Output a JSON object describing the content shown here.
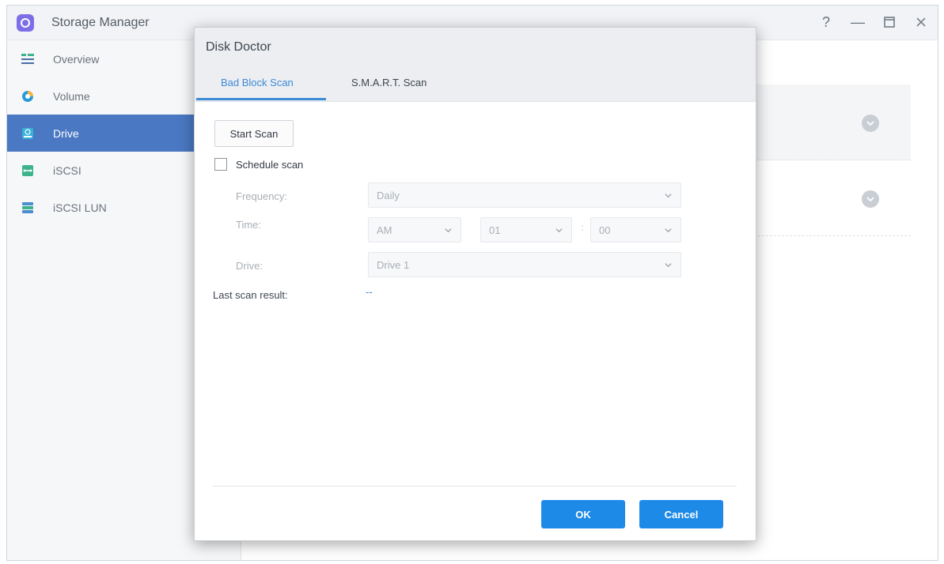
{
  "window": {
    "title": "Storage Manager",
    "controls": {
      "help": "?",
      "minimize": "—"
    }
  },
  "sidebar": {
    "items": [
      {
        "label": "Overview",
        "icon": "overview-icon",
        "active": false
      },
      {
        "label": "Volume",
        "icon": "volume-icon",
        "active": false
      },
      {
        "label": "Drive",
        "icon": "drive-icon",
        "active": true
      },
      {
        "label": "iSCSI",
        "icon": "iscsi-icon",
        "active": false
      },
      {
        "label": "iSCSI LUN",
        "icon": "iscsi-lun-icon",
        "active": false
      }
    ]
  },
  "dialog": {
    "title": "Disk Doctor",
    "tabs": [
      {
        "label": "Bad Block Scan",
        "active": true
      },
      {
        "label": "S.M.A.R.T. Scan",
        "active": false
      }
    ],
    "start_scan": "Start Scan",
    "schedule_label": "Schedule scan",
    "schedule_checked": false,
    "frequency": {
      "label": "Frequency:",
      "value": "Daily"
    },
    "time": {
      "label": "Time:",
      "ampm": "AM",
      "hour": "01",
      "separator": ":",
      "minute": "00"
    },
    "drive": {
      "label": "Drive:",
      "value": "Drive 1"
    },
    "last_scan": {
      "label": "Last scan result:",
      "value": "--"
    },
    "ok": "OK",
    "cancel": "Cancel"
  },
  "colors": {
    "accent": "#3d8ad8",
    "primary_button": "#1e8ae8",
    "sidebar_active": "#4a78c2"
  }
}
